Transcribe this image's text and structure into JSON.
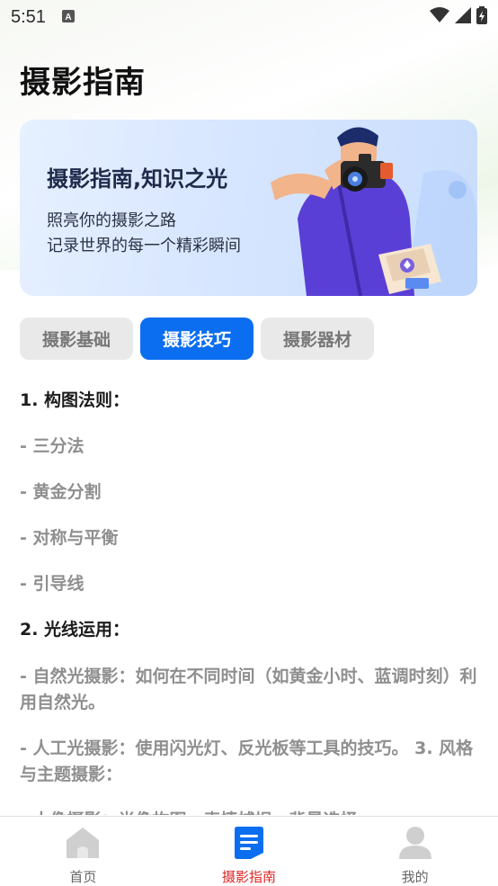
{
  "status_bar": {
    "time": "5:51"
  },
  "page": {
    "title": "摄影指南"
  },
  "banner": {
    "title": "摄影指南,知识之光",
    "subtitle_line1": "照亮你的摄影之路",
    "subtitle_line2": "记录世界的每一个精彩瞬间"
  },
  "tabs": [
    {
      "label": "摄影基础",
      "active": false
    },
    {
      "label": "摄影技巧",
      "active": true
    },
    {
      "label": "摄影器材",
      "active": false
    }
  ],
  "content": {
    "heading1": "1. 构图法则：",
    "item1": "- 三分法",
    "item2": "- 黄金分割",
    "item3": "- 对称与平衡",
    "item4": "- 引导线",
    "heading2": "2. 光线运用：",
    "item5": "- 自然光摄影：如何在不同时间（如黄金小时、蓝调时刻）利用自然光。",
    "item6": "- 人工光摄影：使用闪光灯、反光板等工具的技巧。 3. 风格与主题摄影：",
    "item7": "- 人像摄影：肖像构图、表情捕捉、背景选择"
  },
  "bottom_nav": [
    {
      "label": "首页",
      "icon": "home-icon"
    },
    {
      "label": "摄影指南",
      "icon": "guide-icon",
      "active": true
    },
    {
      "label": "我的",
      "icon": "profile-icon"
    }
  ],
  "colors": {
    "accent": "#0b6ef0",
    "active_nav": "#e02424",
    "muted_text": "#8f8f8f"
  }
}
